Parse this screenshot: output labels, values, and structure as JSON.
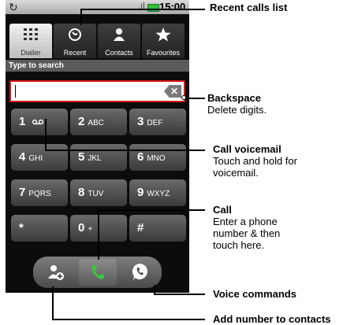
{
  "status_bar": {
    "time": "15:00",
    "signal": ".ıl"
  },
  "tabs": [
    {
      "label": "Dialler",
      "icon": "grid-icon",
      "active": true
    },
    {
      "label": "Recent",
      "icon": "recent-calls-icon",
      "active": false
    },
    {
      "label": "Contacts",
      "icon": "person-icon",
      "active": false
    },
    {
      "label": "Favourites",
      "icon": "star-icon",
      "active": false
    }
  ],
  "search": {
    "label": "Type to search",
    "value": ""
  },
  "keypad": [
    {
      "digit": "1",
      "letters": "voicemail-icon"
    },
    {
      "digit": "2",
      "letters": "ABC"
    },
    {
      "digit": "3",
      "letters": "DEF"
    },
    {
      "digit": "4",
      "letters": "GHI"
    },
    {
      "digit": "5",
      "letters": "JKL"
    },
    {
      "digit": "6",
      "letters": "MNO"
    },
    {
      "digit": "7",
      "letters": "PQRS"
    },
    {
      "digit": "8",
      "letters": "TUV"
    },
    {
      "digit": "9",
      "letters": "WXYZ"
    },
    {
      "digit": "*",
      "letters": ""
    },
    {
      "digit": "0",
      "letters": "+"
    },
    {
      "digit": "#",
      "letters": ""
    }
  ],
  "callouts": {
    "recent": {
      "title": "Recent calls list"
    },
    "backspace": {
      "title": "Backspace",
      "desc": "Delete digits."
    },
    "voicemail": {
      "title": "Call voicemail",
      "desc": "Touch and hold for voicemail."
    },
    "call": {
      "title": "Call",
      "desc": "Enter a phone number & then touch here."
    },
    "voice": {
      "title": "Voice commands"
    },
    "add": {
      "title": "Add number to contacts"
    }
  },
  "colors": {
    "accent_red": "#d81818",
    "call_green": "#3fc23f"
  }
}
